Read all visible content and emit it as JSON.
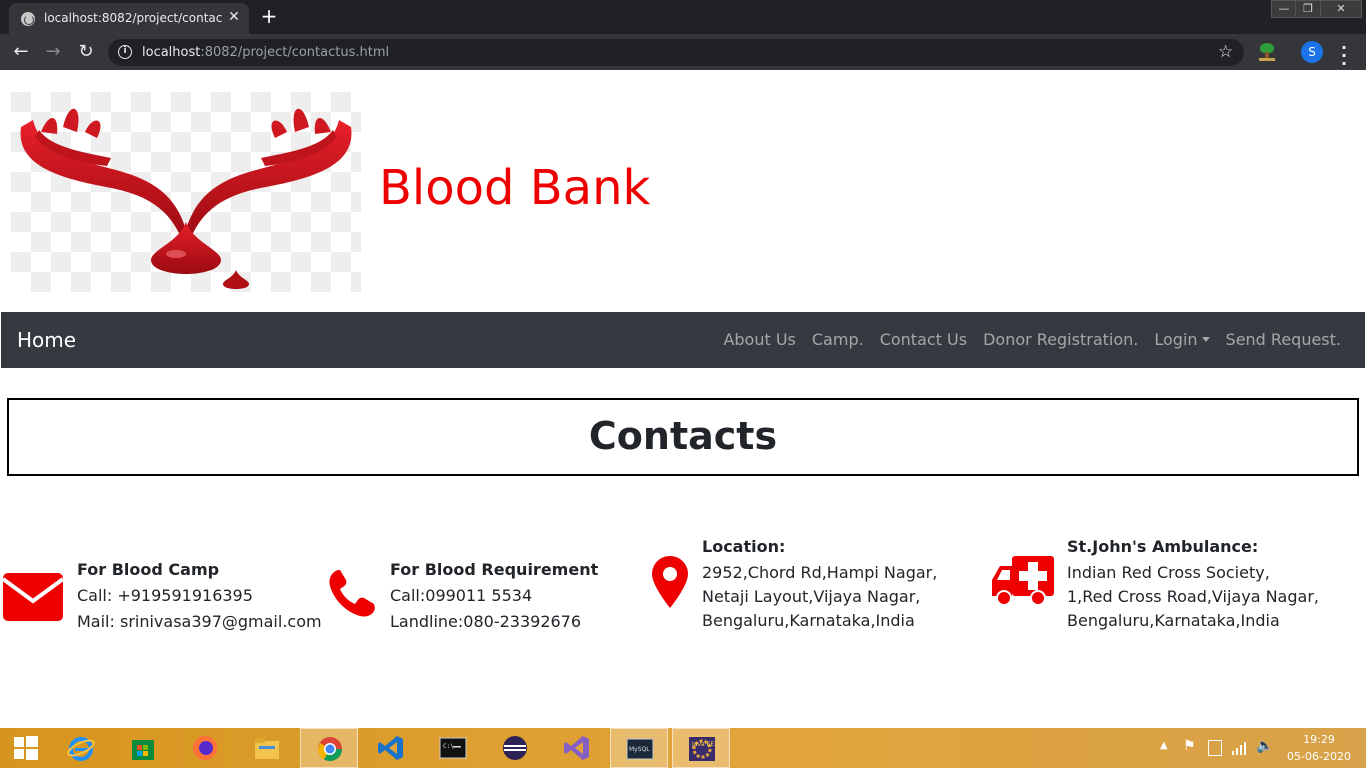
{
  "browser": {
    "tab_title": "localhost:8082/project/contactus.html",
    "tab_close": "✕",
    "new_tab": "+",
    "url_host": "localhost",
    "url_rest": ":8082/project/contactus.html",
    "profile_initial": "S",
    "window_controls": [
      "—",
      "❐",
      "✕"
    ]
  },
  "site": {
    "title": "Blood Bank",
    "title_color": "#ee0000"
  },
  "navbar": {
    "brand": "Home",
    "links": [
      "About Us",
      "Camp.",
      "Contact Us",
      "Donor Registration.",
      "Login",
      "Send Request."
    ]
  },
  "page": {
    "heading": "Contacts"
  },
  "contacts": [
    {
      "icon": "envelope-icon",
      "title": "For Blood Camp",
      "lines": [
        "Call:  +919591916395",
        "Mail:  srinivasa397@gmail.com"
      ]
    },
    {
      "icon": "phone-icon",
      "title": "For Blood Requirement",
      "lines": [
        "Call:099011 5534",
        "Landline:080-23392676"
      ]
    },
    {
      "icon": "location-pin-icon",
      "title": "Location:",
      "lines": [
        "2952,Chord Rd,Hampi Nagar,",
        "Netaji Layout,Vijaya Nagar,",
        "Bengaluru,Karnataka,India"
      ]
    },
    {
      "icon": "ambulance-icon",
      "title": "St.John's Ambulance:",
      "lines": [
        "Indian Red Cross Society,",
        "1,Red Cross Road,Vijaya Nagar,",
        "Bengaluru,Karnataka,India"
      ]
    }
  ],
  "icon_color": "#ee0000",
  "taskbar": {
    "time": "19:29",
    "date": "05-06-2020"
  }
}
